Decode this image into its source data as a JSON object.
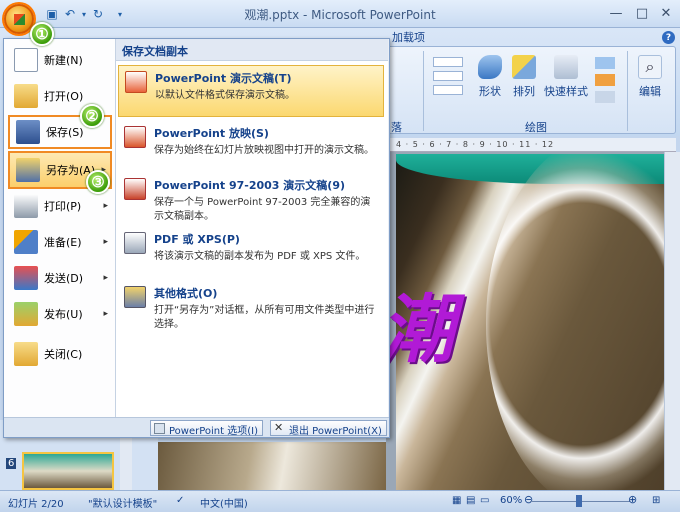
{
  "window": {
    "title": "观潮.pptx - Microsoft PowerPoint",
    "minimize": "—",
    "maximize": "□",
    "close": "✕"
  },
  "ribbon": {
    "tab_addins": "加载项",
    "help": "?",
    "shape_label": "形状",
    "arrange_label": "排列",
    "quickstyle_label": "快速样式",
    "edit_label": "编辑",
    "group_paragraph": "落",
    "group_drawing": "绘图",
    "ruler_marks": "4 · 5 · 6 · 7 · 8 · 9 · 10 · 11 · 12"
  },
  "steps": {
    "one": "①",
    "two": "②",
    "three": "③"
  },
  "menu": {
    "items": [
      {
        "label": "新建(N)"
      },
      {
        "label": "打开(O)"
      },
      {
        "label": "保存(S)"
      },
      {
        "label": "另存为(A)"
      },
      {
        "label": "打印(P)"
      },
      {
        "label": "准备(E)"
      },
      {
        "label": "发送(D)"
      },
      {
        "label": "发布(U)"
      },
      {
        "label": "关闭(C)"
      }
    ],
    "arrow": "▸",
    "submenu_title": "保存文档副本",
    "submenu": [
      {
        "title": "PowerPoint 演示文稿(T)",
        "desc": "以默认文件格式保存演示文稿。"
      },
      {
        "title": "PowerPoint 放映(S)",
        "desc": "保存为始终在幻灯片放映视图中打开的演示文稿。"
      },
      {
        "title": "PowerPoint 97-2003 演示文稿(9)",
        "desc": "保存一个与 PowerPoint 97-2003 完全兼容的演示文稿副本。"
      },
      {
        "title": "PDF 或 XPS(P)",
        "desc": "将该演示文稿的副本发布为 PDF 或 XPS 文件。"
      },
      {
        "title": "其他格式(O)",
        "desc": "打开“另存为”对话框，从所有可用文件类型中进行选择。"
      }
    ],
    "options_button": "PowerPoint 选项(I)",
    "exit_button": "退出 PowerPoint(X)"
  },
  "slide": {
    "char": "潮",
    "thumb_number": "6"
  },
  "status": {
    "slide": "幻灯片 2/20",
    "theme": "\"默认设计模板\"",
    "language": "中文(中国)",
    "zoom": "60%",
    "zoom_minus": "⊖",
    "zoom_plus": "⊕"
  },
  "colors": {
    "accent": "#f08a24",
    "menu_text": "#15428b",
    "slide_text": "#b11ad6"
  }
}
